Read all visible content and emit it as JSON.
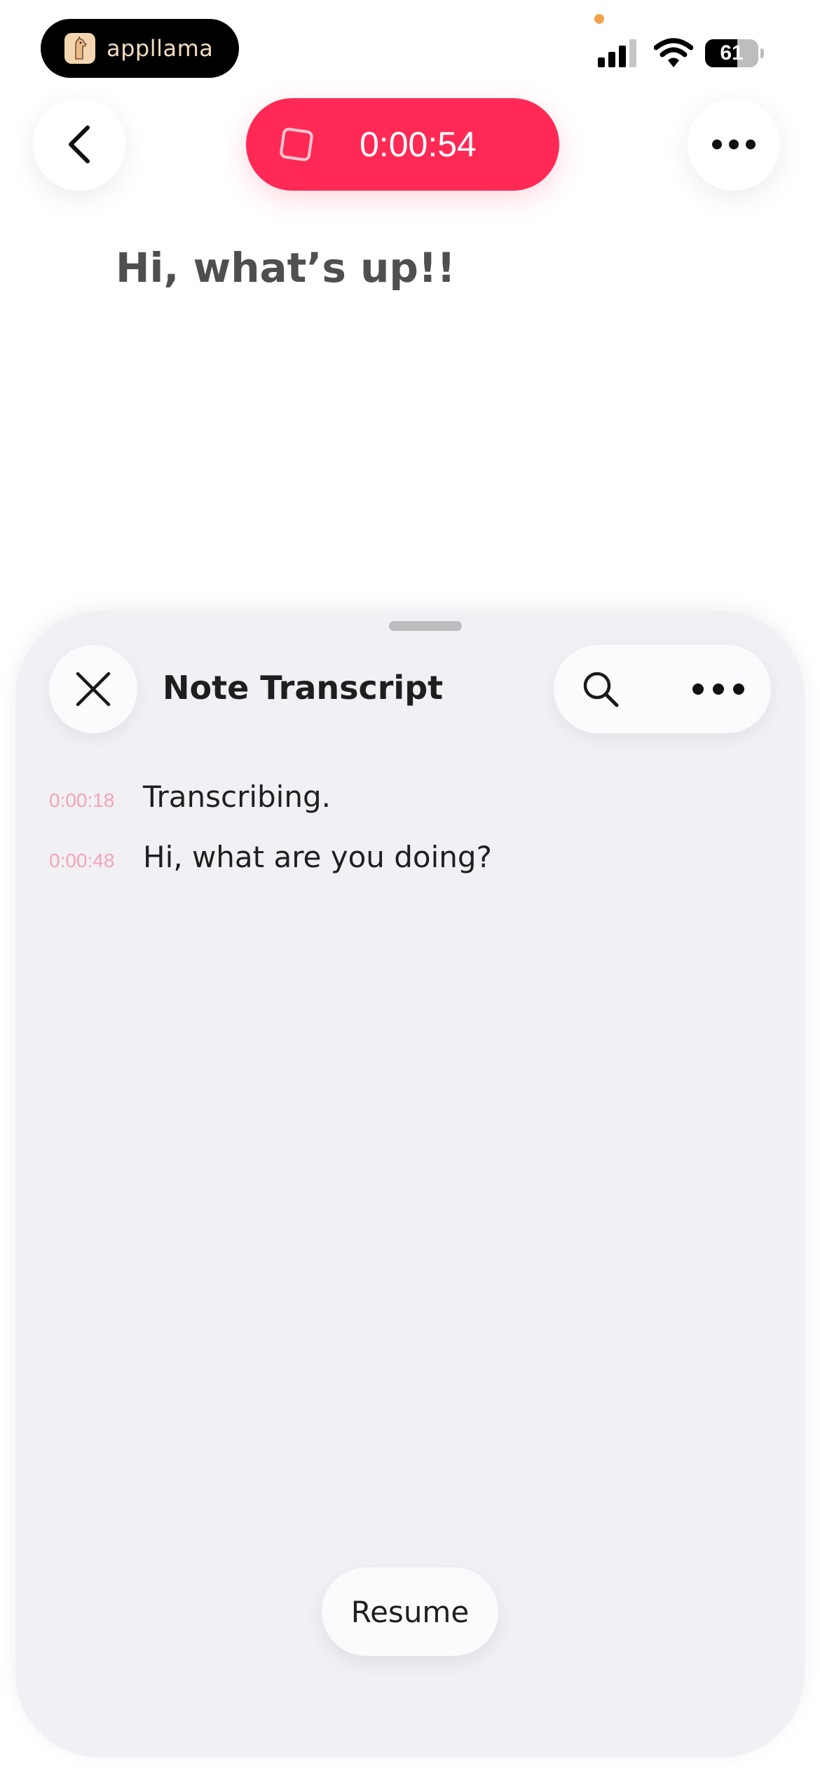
{
  "status_bar": {
    "app_name": "appllama",
    "battery_level": "61",
    "battery_fraction": 0.61,
    "recording_dot_color": "#f3a04a"
  },
  "header": {
    "back_icon": "chevron-left-icon",
    "recording_timer": "0:00:54",
    "stop_icon": "stop-square-icon",
    "more_icon": "ellipsis-icon",
    "accent_color": "#fe2a55"
  },
  "note": {
    "text": "Hi, what’s up!!"
  },
  "transcript_sheet": {
    "title": "Note Transcript",
    "close_icon": "close-icon",
    "search_icon": "search-icon",
    "more_icon": "ellipsis-icon",
    "entries": [
      {
        "time": "0:00:18",
        "text": "Transcribing."
      },
      {
        "time": "0:00:48",
        "text": "Hi, what are you doing?"
      }
    ],
    "resume_label": "Resume"
  }
}
